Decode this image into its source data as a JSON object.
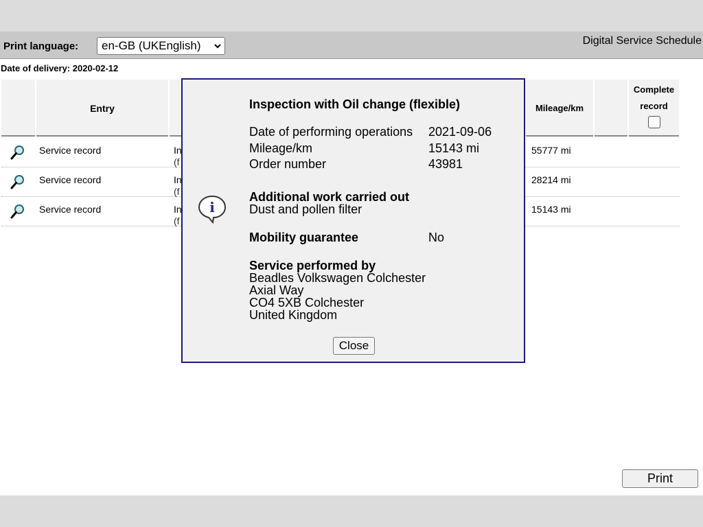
{
  "header": {
    "print_language_label": "Print language:",
    "language_selected": "en-GB (UKEnglish)",
    "app_title": "Digital Service Schedule"
  },
  "delivery": {
    "label": "Date of delivery: 2020-02-12"
  },
  "table": {
    "headers": {
      "entry": "Entry",
      "mileage": "Mileage/km",
      "complete_record_line1": "Complete",
      "complete_record_line2": "record"
    },
    "rows": [
      {
        "icon": "magnifier-icon",
        "entry": "Service record",
        "desc1": "In",
        "desc2": "(f",
        "mileage": "55777 mi"
      },
      {
        "icon": "magnifier-icon",
        "entry": "Service record",
        "desc1": "In",
        "desc2": "(f",
        "mileage": "28214 mi"
      },
      {
        "icon": "magnifier-icon",
        "entry": "Service record",
        "desc1": "In",
        "desc2": "(f",
        "mileage": "15143 mi"
      }
    ]
  },
  "dialog": {
    "icon": "info-icon",
    "title": "Inspection with Oil change (flexible)",
    "fields": [
      {
        "label": "Date of performing operations",
        "value": "2021-09-06"
      },
      {
        "label": "Mileage/km",
        "value": "15143 mi"
      },
      {
        "label": "Order number",
        "value": "43981"
      }
    ],
    "additional_work_heading": "Additional work carried out",
    "additional_work_text": "Dust and pollen filter",
    "mobility_label": "Mobility guarantee",
    "mobility_value": "No",
    "service_heading": "Service performed by",
    "service_lines": [
      "Beadles Volkswagen Colchester",
      "Axial Way",
      "CO4 5XB Colchester",
      "United Kingdom"
    ],
    "close_label": "Close"
  },
  "print_button_label": "Print"
}
